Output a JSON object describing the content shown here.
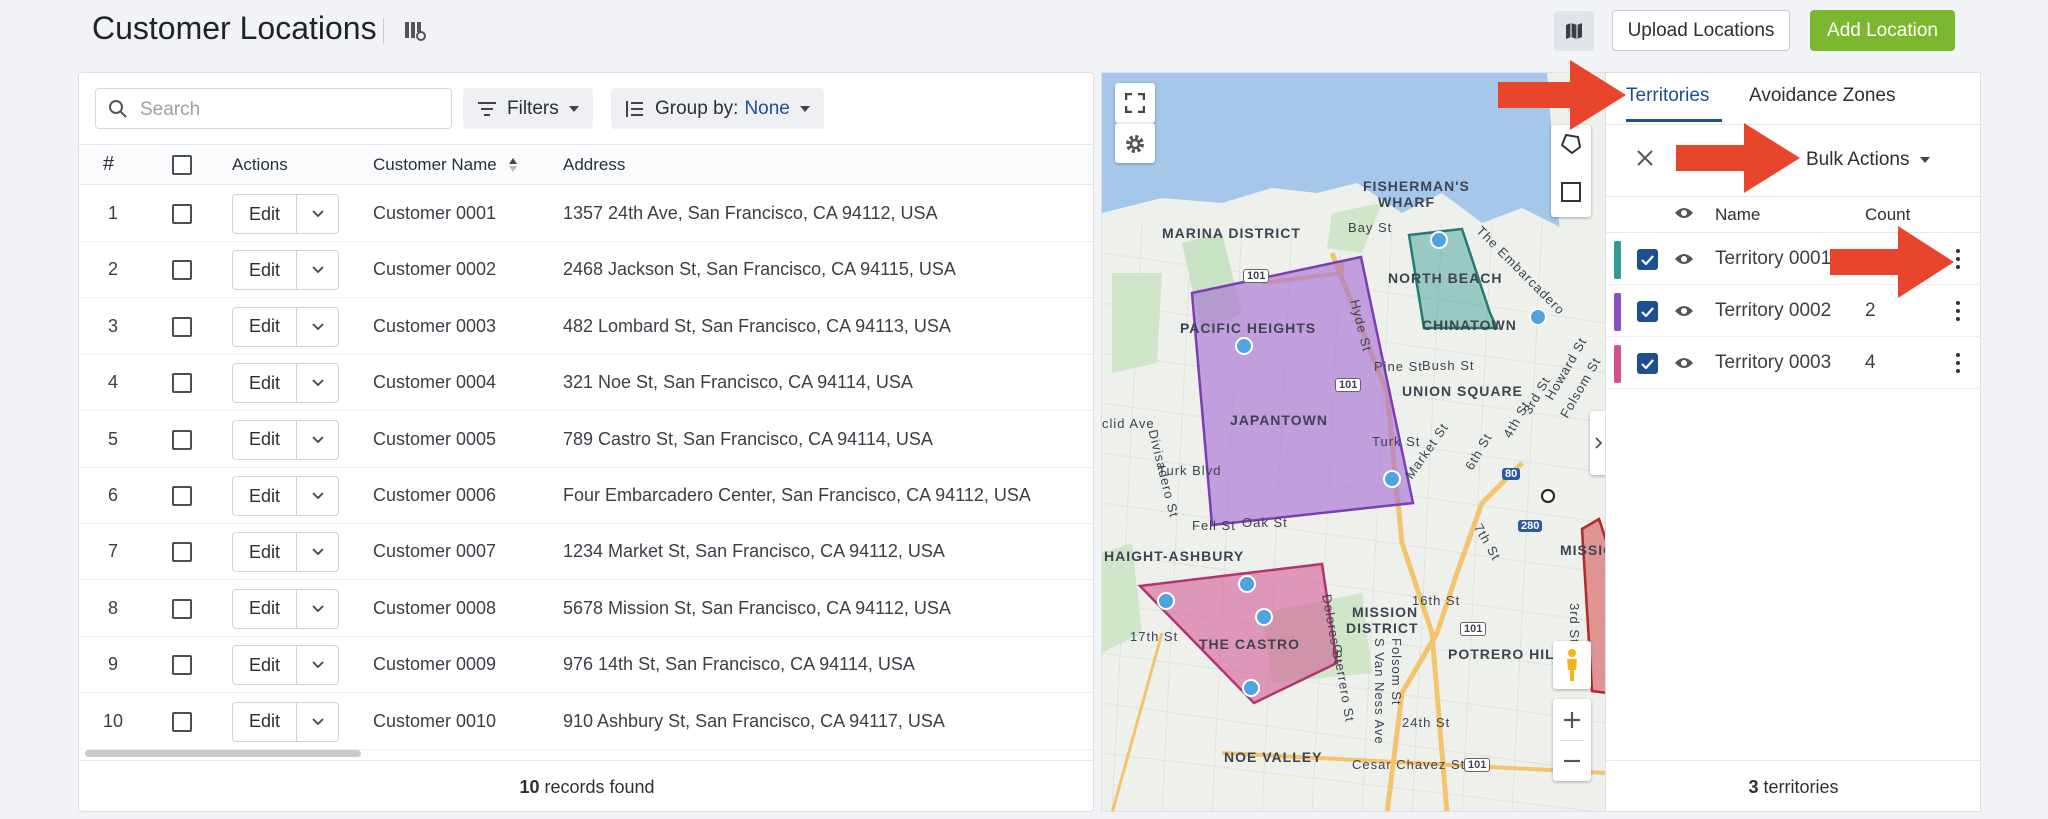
{
  "page": {
    "title": "Customer Locations"
  },
  "header": {
    "upload_label": "Upload Locations",
    "add_label": "Add Location"
  },
  "toolbar": {
    "search_placeholder": "Search",
    "filters_label": "Filters",
    "groupby_prefix": "Group by:",
    "groupby_value": "None"
  },
  "table": {
    "columns": {
      "num": "#",
      "actions": "Actions",
      "name": "Customer Name",
      "address": "Address"
    },
    "edit_label": "Edit",
    "rows": [
      {
        "num": "1",
        "name": "Customer 0001",
        "address": "1357 24th Ave, San Francisco, CA 94112, USA"
      },
      {
        "num": "2",
        "name": "Customer 0002",
        "address": "2468 Jackson St, San Francisco, CA 94115, USA"
      },
      {
        "num": "3",
        "name": "Customer 0003",
        "address": "482 Lombard St, San Francisco, CA 94113, USA"
      },
      {
        "num": "4",
        "name": "Customer 0004",
        "address": "321 Noe St, San Francisco, CA 94114, USA"
      },
      {
        "num": "5",
        "name": "Customer 0005",
        "address": "789 Castro St, San Francisco, CA 94114, USA"
      },
      {
        "num": "6",
        "name": "Customer 0006",
        "address": "Four Embarcadero Center, San Francisco, CA 94112, USA"
      },
      {
        "num": "7",
        "name": "Customer 0007",
        "address": "1234 Market St, San Francisco, CA 94112, USA"
      },
      {
        "num": "8",
        "name": "Customer 0008",
        "address": "5678 Mission St, San Francisco, CA 94112, USA"
      },
      {
        "num": "9",
        "name": "Customer 0009",
        "address": "976 14th St, San Francisco, CA 94114, USA"
      },
      {
        "num": "10",
        "name": "Customer 0010",
        "address": "910 Ashbury St, San Francisco, CA 94117, USA"
      }
    ],
    "footer_count": "10",
    "footer_text": "records found"
  },
  "map": {
    "labels": {
      "fishermans": "FISHERMAN'S",
      "wharf": "WHARF",
      "marina": "MARINA DISTRICT",
      "northbeach": "NORTH BEACH",
      "pacific": "PACIFIC HEIGHTS",
      "chinatown": "CHINATOWN",
      "union": "UNION SQUARE",
      "japantown": "JAPANTOWN",
      "haight": "HAIGHT-ASHBURY",
      "castro": "THE CASTRO",
      "mission1": "MISSION",
      "mission2": "DISTRICT",
      "mission_edge": "MISSION",
      "potrero": "POTRERO HILL",
      "noe": "NOE VALLEY",
      "bay": "Bay St",
      "divisadero": "Divisadero St",
      "hyde": "Hyde St",
      "pine": "Pine St",
      "bush": "Bush St",
      "turk": "Turk Blvd",
      "turk_st": "Turk St",
      "fell": "Fell St",
      "oak": "Oak St",
      "clid": "clid Ave",
      "market": "Market St",
      "s16": "16th St",
      "s17": "17th St",
      "s24": "24th St",
      "cesar": "Cesar Chavez St",
      "dolores": "Dolores St",
      "guerrero": "Guerrero St",
      "folsom": "Folsom St",
      "vanness": "S Van Ness Ave",
      "s7th": "7th St",
      "s3rd": "3rd St",
      "s4th": "4th St",
      "s6th": "6th St",
      "howard": "Howard St",
      "folsom2": "Folsom St",
      "embarcadero": "The Embarcadero",
      "hw101": "101",
      "hw80": "80",
      "hw280": "280"
    }
  },
  "sidebar": {
    "tabs": {
      "territories": "Territories",
      "avoidance": "Avoidance Zones"
    },
    "bulk_label": "Bulk Actions",
    "cols": {
      "name": "Name",
      "count": "Count"
    },
    "items": [
      {
        "name": "Territory 0001",
        "count": "",
        "color": "#2f9c93"
      },
      {
        "name": "Territory 0002",
        "count": "2",
        "color": "#8e4fc6"
      },
      {
        "name": "Territory 0003",
        "count": "4",
        "color": "#d24f90"
      }
    ],
    "footer_count": "3",
    "footer_text": "territories"
  },
  "colors": {
    "accent": "#1d4f91",
    "add": "#7cb82f",
    "arrow": "#e8452c"
  }
}
